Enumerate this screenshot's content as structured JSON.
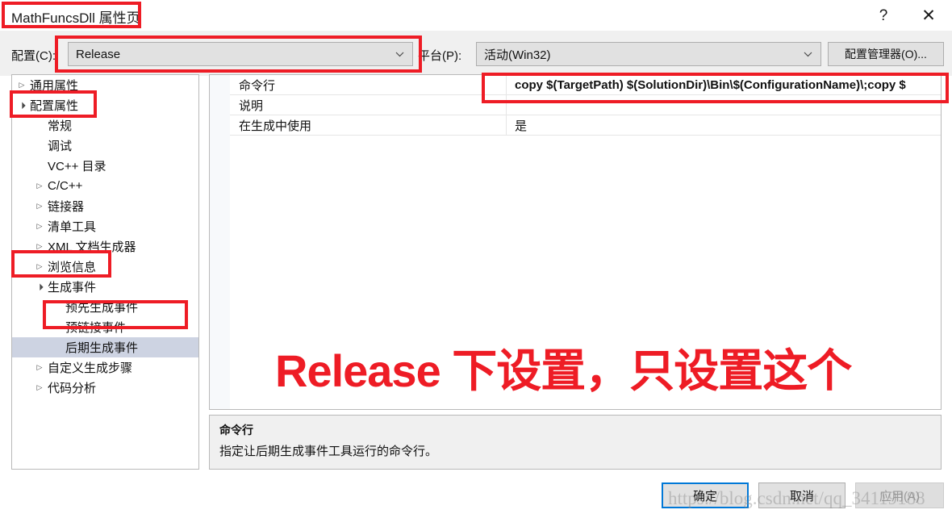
{
  "window": {
    "title": "MathFuncsDll 属性页",
    "help_label": "?",
    "close_label": "✕"
  },
  "config_bar": {
    "config_label": "配置(C):",
    "config_value": "Release",
    "platform_label": "平台(P):",
    "platform_value": "活动(Win32)",
    "config_manager_label": "配置管理器(O)..."
  },
  "tree": {
    "items": [
      {
        "label": "通用属性",
        "twisty": "▷",
        "indent": 0,
        "selected": false
      },
      {
        "label": "配置属性",
        "twisty": "▲",
        "indent": 0,
        "selected": false
      },
      {
        "label": "常规",
        "twisty": "",
        "indent": 1,
        "selected": false
      },
      {
        "label": "调试",
        "twisty": "",
        "indent": 1,
        "selected": false
      },
      {
        "label": "VC++ 目录",
        "twisty": "",
        "indent": 1,
        "selected": false
      },
      {
        "label": "C/C++",
        "twisty": "▷",
        "indent": 1,
        "selected": false
      },
      {
        "label": "链接器",
        "twisty": "▷",
        "indent": 1,
        "selected": false
      },
      {
        "label": "清单工具",
        "twisty": "▷",
        "indent": 1,
        "selected": false
      },
      {
        "label": "XML 文档生成器",
        "twisty": "▷",
        "indent": 1,
        "selected": false
      },
      {
        "label": "浏览信息",
        "twisty": "▷",
        "indent": 1,
        "selected": false
      },
      {
        "label": "生成事件",
        "twisty": "▲",
        "indent": 1,
        "selected": false
      },
      {
        "label": "预先生成事件",
        "twisty": "",
        "indent": 2,
        "selected": false
      },
      {
        "label": "预链接事件",
        "twisty": "",
        "indent": 2,
        "selected": false
      },
      {
        "label": "后期生成事件",
        "twisty": "",
        "indent": 2,
        "selected": true
      },
      {
        "label": "自定义生成步骤",
        "twisty": "▷",
        "indent": 1,
        "selected": false
      },
      {
        "label": "代码分析",
        "twisty": "▷",
        "indent": 1,
        "selected": false
      }
    ]
  },
  "grid": {
    "rows": [
      {
        "name": "命令行",
        "value": "copy $(TargetPath)    $(SolutionDir)\\Bin\\$(ConfigurationName)\\;copy $",
        "bold": true
      },
      {
        "name": "说明",
        "value": "",
        "bold": false
      },
      {
        "name": "在生成中使用",
        "value": "是",
        "bold": false
      }
    ]
  },
  "description": {
    "title": "命令行",
    "body": "指定让后期生成事件工具运行的命令行。"
  },
  "footer": {
    "ok_label": "确定",
    "cancel_label": "取消",
    "apply_label": "应用(A)"
  },
  "annotations": {
    "red_text": "Release 下设置，只设置这个",
    "accent_color": "#ee1c25",
    "watermark": "https://blog.csdn.net/qq_34119188"
  }
}
